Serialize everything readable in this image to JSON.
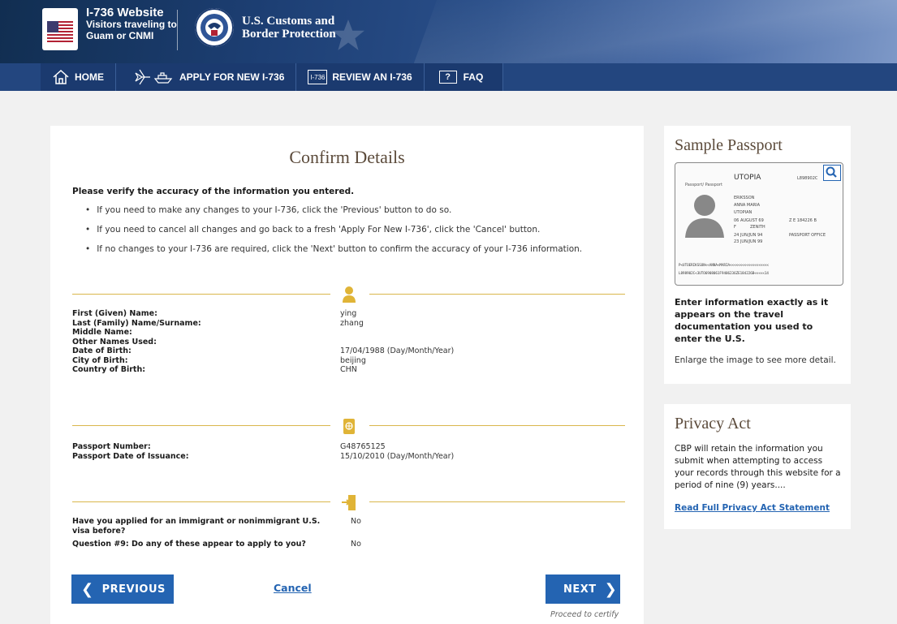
{
  "header": {
    "site_title": "I-736 Website",
    "site_subtitle_line1": "Visitors traveling to",
    "site_subtitle_line2": "Guam or CNMI",
    "agency_line1": "U.S. Customs and",
    "agency_line2": "Border Protection"
  },
  "nav": {
    "home": "HOME",
    "apply": "APPLY FOR NEW I-736",
    "review": "REVIEW AN I-736",
    "review_icon_text": "I-736",
    "faq": "FAQ",
    "faq_icon_text": "?"
  },
  "main": {
    "title": "Confirm Details",
    "intro": "Please verify the accuracy of the information you entered.",
    "bullets": [
      "If you need to make any changes to your I-736, click the 'Previous' button to do so.",
      "If you need to cancel all changes and go back to a fresh 'Apply For New I-736', click the 'Cancel' button.",
      "If no changes to your I-736 are required, click the 'Next' button to confirm the accuracy of your I-736 information."
    ],
    "personal": [
      {
        "label": "First (Given) Name:",
        "value": "ying"
      },
      {
        "label": "Last (Family) Name/Surname:",
        "value": "zhang"
      },
      {
        "label": "Middle Name:",
        "value": ""
      },
      {
        "label": "Other Names Used:",
        "value": ""
      },
      {
        "label": "Date of Birth:",
        "value": "17/04/1988 (Day/Month/Year)"
      },
      {
        "label": "City of Birth:",
        "value": "beijing"
      },
      {
        "label": "Country of Birth:",
        "value": "CHN"
      }
    ],
    "passport": [
      {
        "label": "Passport Number:",
        "value": "G48765125"
      },
      {
        "label": "Passport Date of Issuance:",
        "value": "15/10/2010 (Day/Month/Year)"
      }
    ],
    "questions": [
      {
        "label": "Have you applied for an immigrant or nonimmigrant U.S. visa before?",
        "value": "No"
      },
      {
        "label": "Question #9: Do any of these appear to apply to you?",
        "value": "No"
      }
    ],
    "previous_label": "PREVIOUS",
    "cancel_label": "Cancel",
    "next_label": "NEXT",
    "proceed_text": "Proceed to certify"
  },
  "sample_passport": {
    "title": "Sample Passport",
    "instruction": "Enter information exactly as it appears on the travel documentation you used to enter the U.S.",
    "note": "Enlarge the image to see more detail.",
    "image": {
      "country": "UTOPIA",
      "doc_label": "Passport/ Passport",
      "surname": "ERIKSSON",
      "given_names": "ANNA MARIA",
      "nationality": "UTOPIAN",
      "dob": "06 AUGUST 69",
      "sex": "F",
      "pob": "ZENITH",
      "issue_date": "24 JUN/JUN 94",
      "expiry_date": "23 JUN/JUN 99",
      "personal_no": "Z E 184226 B",
      "authority": "PASSPORT OFFICE",
      "passport_no": "L898902C",
      "mrz1": "P<UTOERIKSSON<<ANNA<MARIA<<<<<<<<<<<<<<<<<<<",
      "mrz2": "L898902C<3UTO6908061F9406236ZE184226B<<<<<14"
    }
  },
  "privacy": {
    "title": "Privacy Act",
    "text": "CBP will retain the information you submit when attempting to access your records through this website for a period of nine (9) years....",
    "link": "Read Full Privacy Act Statement"
  },
  "colors": {
    "primary_blue": "#2464b2",
    "nav_blue": "#1b3a6f",
    "gold": "#d9b64c",
    "heading_brown": "#5b4a3a"
  },
  "icons": [
    "home-icon",
    "airplane-ship-icon",
    "i736-icon",
    "faq-icon",
    "person-icon",
    "passport-icon",
    "exit-door-icon",
    "magnify-icon",
    "chevron-left-icon",
    "chevron-right-icon"
  ]
}
